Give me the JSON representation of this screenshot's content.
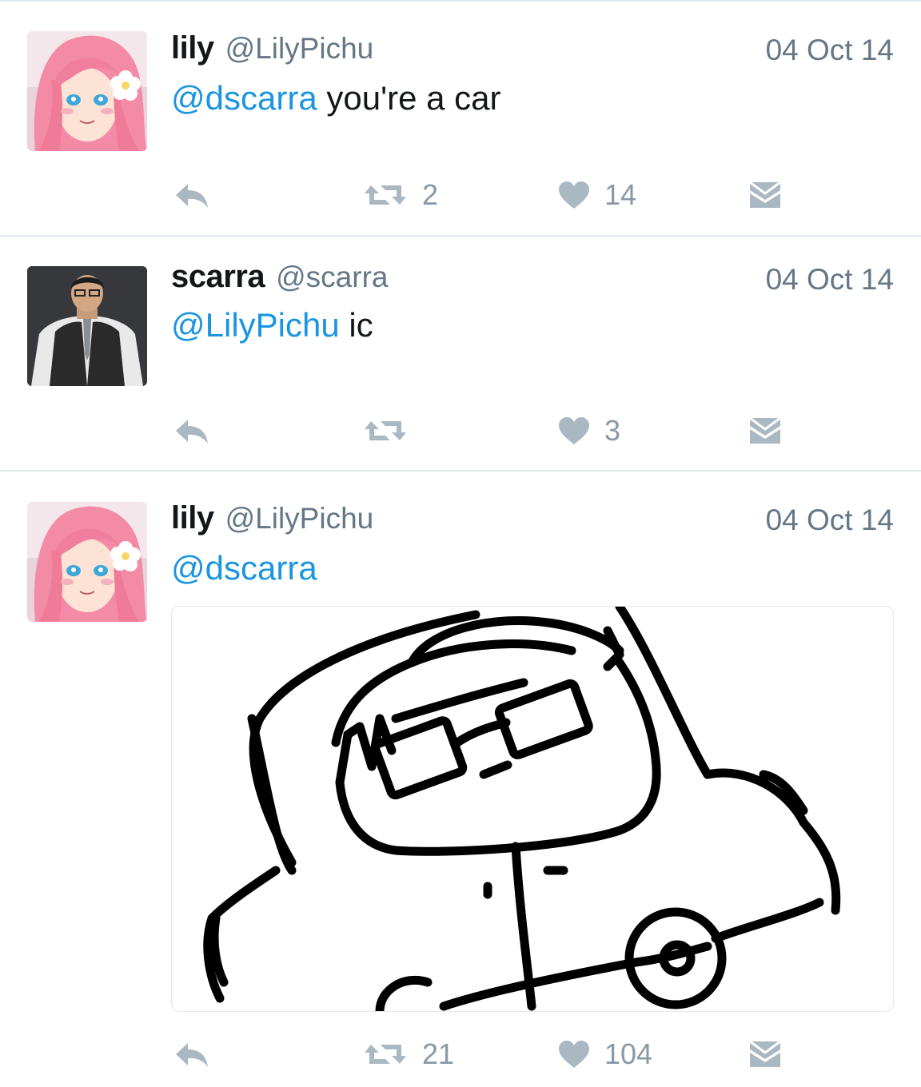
{
  "colors": {
    "mention": "#1b95e0",
    "meta": "#657786",
    "icon": "#aab8c2",
    "divider": "#e1e8ed"
  },
  "tweets": [
    {
      "name": "lily",
      "handle": "@LilyPichu",
      "date": "04 Oct 14",
      "mention": "@dscarra",
      "body": " you're a car",
      "retweets": "2",
      "likes": "14",
      "avatar": "anime-girl-avatar"
    },
    {
      "name": "scarra",
      "handle": "@scarra",
      "date": "04 Oct 14",
      "mention": "@LilyPichu",
      "body": " ic",
      "retweets": "",
      "likes": "3",
      "avatar": "man-in-vest-avatar"
    },
    {
      "name": "lily",
      "handle": "@LilyPichu",
      "date": "04 Oct 14",
      "mention": "@dscarra",
      "body": "",
      "retweets": "21",
      "likes": "104",
      "avatar": "anime-girl-avatar",
      "media": "car-doodle-drawing"
    }
  ],
  "icons": {
    "reply": "reply-icon",
    "retweet": "retweet-icon",
    "like": "heart-icon",
    "dm": "direct-message-icon"
  }
}
